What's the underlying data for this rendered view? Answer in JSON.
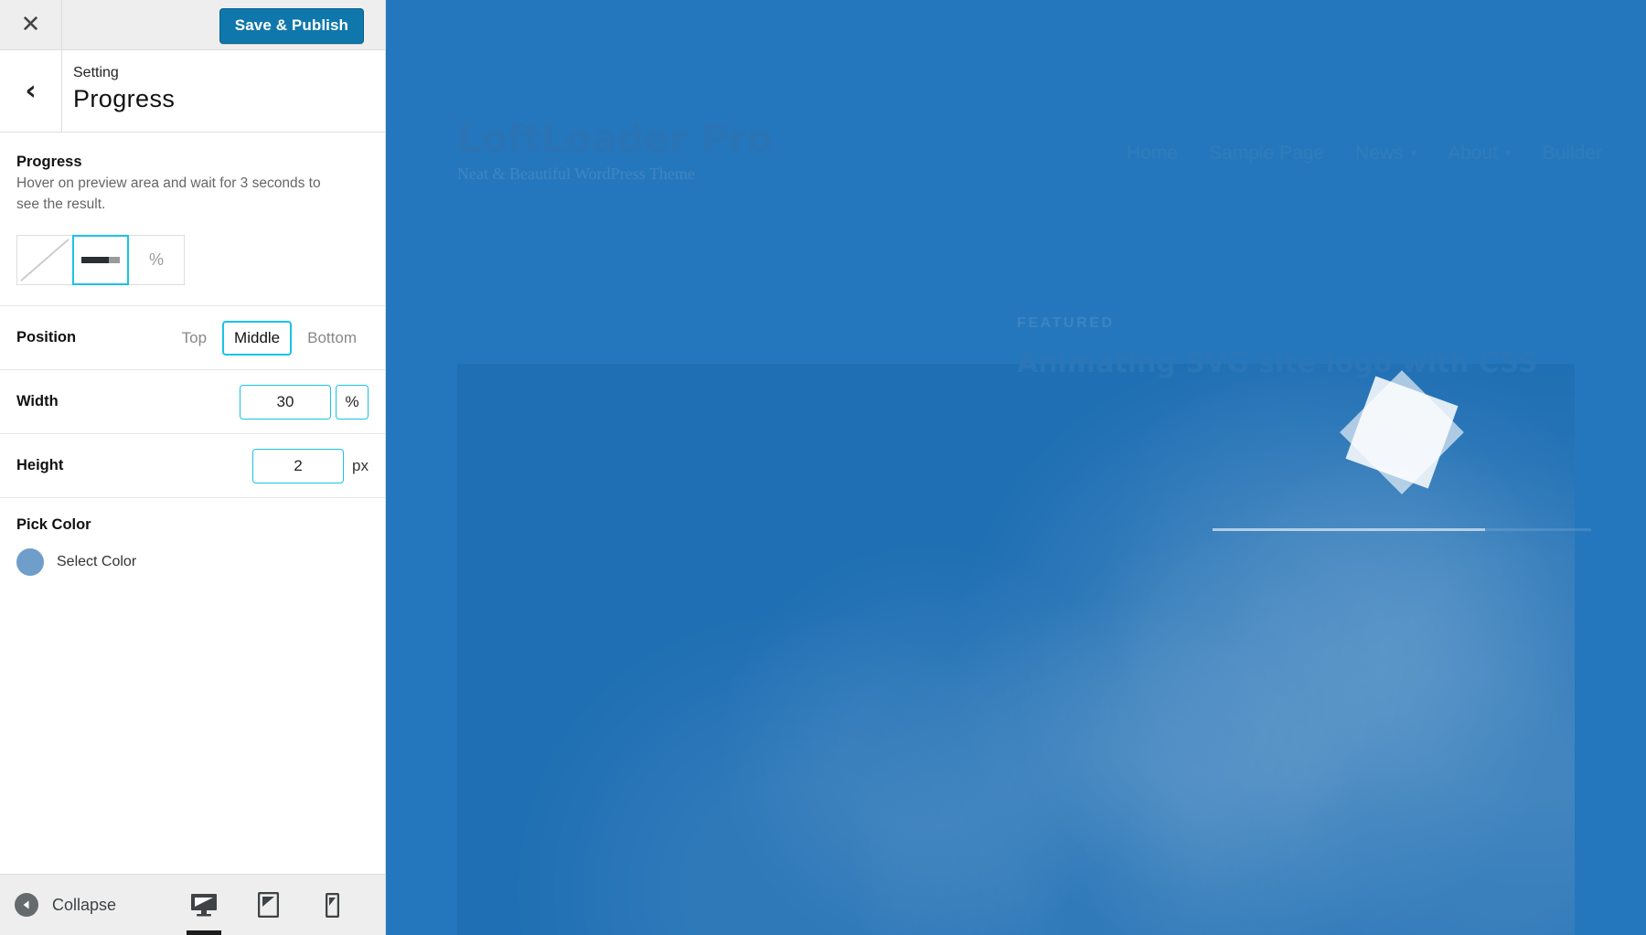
{
  "customizer": {
    "close_icon": "close-icon",
    "save_label": "Save & Publish",
    "back_icon": "chevron-left-icon",
    "breadcrumb_label": "Setting",
    "panel_title": "Progress",
    "accent_color": "#19c3e6",
    "save_button_color": "#0f77ab"
  },
  "progress_section": {
    "title": "Progress",
    "description": "Hover on preview area and wait for 3 seconds to see the result.",
    "styles": [
      {
        "name": "style-none",
        "icon": "diagonal-slash-icon",
        "label": "",
        "selected": false
      },
      {
        "name": "style-bar",
        "icon": "progress-bar-icon",
        "label": "",
        "selected": true
      },
      {
        "name": "style-percent",
        "icon": "percent-icon",
        "label": "%",
        "selected": false
      }
    ]
  },
  "position": {
    "label": "Position",
    "options": [
      {
        "label": "Top",
        "selected": false
      },
      {
        "label": "Middle",
        "selected": true
      },
      {
        "label": "Bottom",
        "selected": false
      }
    ]
  },
  "width": {
    "label": "Width",
    "value": "30",
    "placeholder": "30",
    "unit": "%"
  },
  "height": {
    "label": "Height",
    "value": "2",
    "placeholder": "2",
    "unit": "px"
  },
  "pick_color": {
    "title": "Pick Color",
    "swatch_color": "#6f9ecb",
    "button_label": "Select Color"
  },
  "footer": {
    "collapse_label": "Collapse",
    "collapse_icon": "collapse-left-arrow-icon",
    "devices": [
      {
        "name": "desktop",
        "icon": "desktop-icon",
        "active": true
      },
      {
        "name": "tablet",
        "icon": "tablet-icon",
        "active": false
      },
      {
        "name": "mobile",
        "icon": "mobile-icon",
        "active": false
      }
    ]
  },
  "preview": {
    "site_title": "LoftLoader Pro",
    "site_tagline": "Neat & Beautiful WordPress Theme",
    "nav": [
      {
        "label": "Home",
        "has_caret": false
      },
      {
        "label": "Sample Page",
        "has_caret": false
      },
      {
        "label": "News",
        "has_caret": true
      },
      {
        "label": "About",
        "has_caret": true
      },
      {
        "label": "Builder",
        "has_caret": false
      }
    ],
    "featured_kicker": "FEATURED",
    "featured_title": "Animating SVG site logo with CSS",
    "loader_icon": "star-burst-loader-icon",
    "progress_percent": 72,
    "background_color": "#2577bd"
  }
}
